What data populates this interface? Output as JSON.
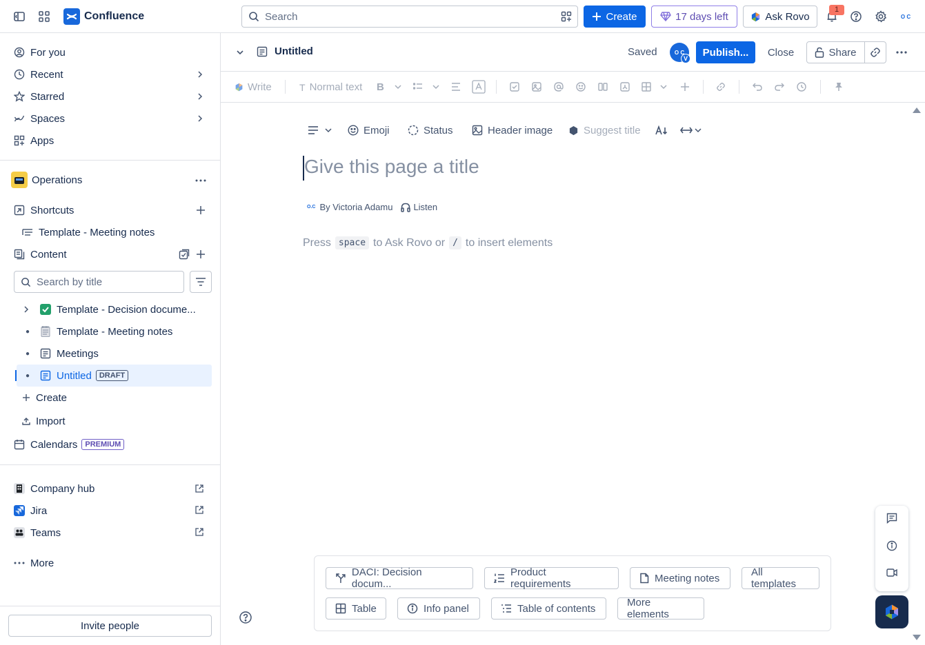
{
  "topbar": {
    "app_name": "Confluence",
    "search_placeholder": "Search",
    "create_label": "Create",
    "trial_label": "17 days left",
    "ask_rovo_label": "Ask Rovo",
    "notification_count": "1",
    "profile_initials": "O C"
  },
  "sidebar": {
    "nav": [
      {
        "label": "For you",
        "icon": "user-circle-icon"
      },
      {
        "label": "Recent",
        "icon": "clock-icon"
      },
      {
        "label": "Starred",
        "icon": "star-icon"
      },
      {
        "label": "Spaces",
        "icon": "spaces-icon"
      },
      {
        "label": "Apps",
        "icon": "apps-icon"
      }
    ],
    "space_name": "Operations",
    "shortcuts_label": "Shortcuts",
    "shortcut_item": "Template - Meeting notes",
    "content_label": "Content",
    "search_placeholder": "Search by title",
    "tree": [
      {
        "label": "Template - Decision docume...",
        "icon": "check-emoji-icon"
      },
      {
        "label": "Template - Meeting notes",
        "icon": "notepad-emoji-icon"
      },
      {
        "label": "Meetings",
        "icon": "page-icon"
      },
      {
        "label": "Untitled",
        "icon": "page-icon",
        "badge": "DRAFT"
      }
    ],
    "create_label": "Create",
    "import_label": "Import",
    "calendars_label": "Calendars",
    "calendars_badge": "PREMIUM",
    "apps": [
      {
        "label": "Company hub"
      },
      {
        "label": "Jira"
      },
      {
        "label": "Teams"
      }
    ],
    "more_label": "More",
    "invite_label": "Invite people"
  },
  "page_header": {
    "title": "Untitled",
    "status": "Saved",
    "avatar_initials": "O C",
    "avatar_sub": "V",
    "publish_label": "Publish...",
    "close_label": "Close",
    "share_label": "Share"
  },
  "toolbar": {
    "write_label": "Write",
    "text_style_label": "Normal text"
  },
  "editor": {
    "emoji_label": "Emoji",
    "status_label": "Status",
    "header_image_label": "Header image",
    "suggest_title_label": "Suggest title",
    "title_placeholder": "Give this page a title",
    "byline": "By Victoria Adamu",
    "listen_label": "Listen",
    "hint_press": "Press",
    "hint_key_space": "space",
    "hint_middle": "to Ask Rovo or",
    "hint_key_slash": "/",
    "hint_end": "to insert elements"
  },
  "templates": {
    "row1": [
      "DACI: Decision docum...",
      "Product requirements",
      "Meeting notes",
      "All templates"
    ],
    "row2": [
      "Table",
      "Info panel",
      "Table of contents",
      "More elements"
    ]
  },
  "colors": {
    "brand_blue": "#0c66e4",
    "trial_purple": "#5e4db2",
    "selected_bg": "#e9f2ff",
    "space_icon": "#f5cd47"
  }
}
